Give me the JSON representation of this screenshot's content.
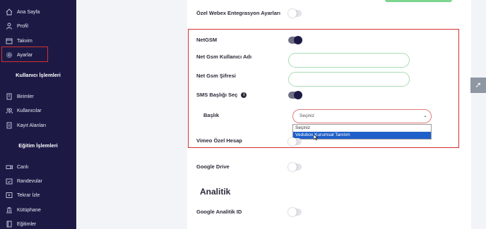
{
  "sidebar": {
    "items": [
      {
        "label": "Ana Sayfa",
        "icon": "home-icon"
      },
      {
        "label": "Profil",
        "icon": "user-icon"
      },
      {
        "label": "Takvim",
        "icon": "calendar-icon"
      },
      {
        "label": "Ayarlar",
        "icon": "gear-icon"
      },
      {
        "label": "Birimler",
        "icon": "building-icon"
      },
      {
        "label": "Kullanıcılar",
        "icon": "users-icon"
      },
      {
        "label": "Kayıt Alanları",
        "icon": "document-icon"
      },
      {
        "label": "Canlı",
        "icon": "video-icon"
      },
      {
        "label": "Randevular",
        "icon": "appointment-icon"
      },
      {
        "label": "Tekrar İzle",
        "icon": "replay-icon"
      },
      {
        "label": "Kütüphane",
        "icon": "library-icon"
      },
      {
        "label": "Eğitimler",
        "icon": "book-icon"
      }
    ],
    "sections": {
      "users": "Kullanıcı İşlemleri",
      "education": "Eğitim İşlemleri"
    }
  },
  "settings": {
    "webex_label": "Özel Webex Entegrasyon Ayarları",
    "netgsm_label": "NetGSM",
    "netgsm_user_label": "Net Gsm Kullanıcı Adı",
    "netgsm_password_label": "Net Gsm Şifresi",
    "sms_header_label": "SMS Başlığı Seç",
    "baslik_label": "Başlık",
    "vimeo_label": "Vimeo Özel Hesap",
    "google_drive_label": "Google Drive",
    "analytics_title": "Analitik",
    "google_analytics_label": "Google Analitik ID"
  },
  "select": {
    "value": "Seçiniz",
    "options": [
      "Seçiniz",
      "Vedubox Kurumsal Tanıtım"
    ]
  },
  "colors": {
    "sidebar_bg": "#1c1a45",
    "highlight": "#d32f2f",
    "selected_option": "#1f5fc9"
  }
}
